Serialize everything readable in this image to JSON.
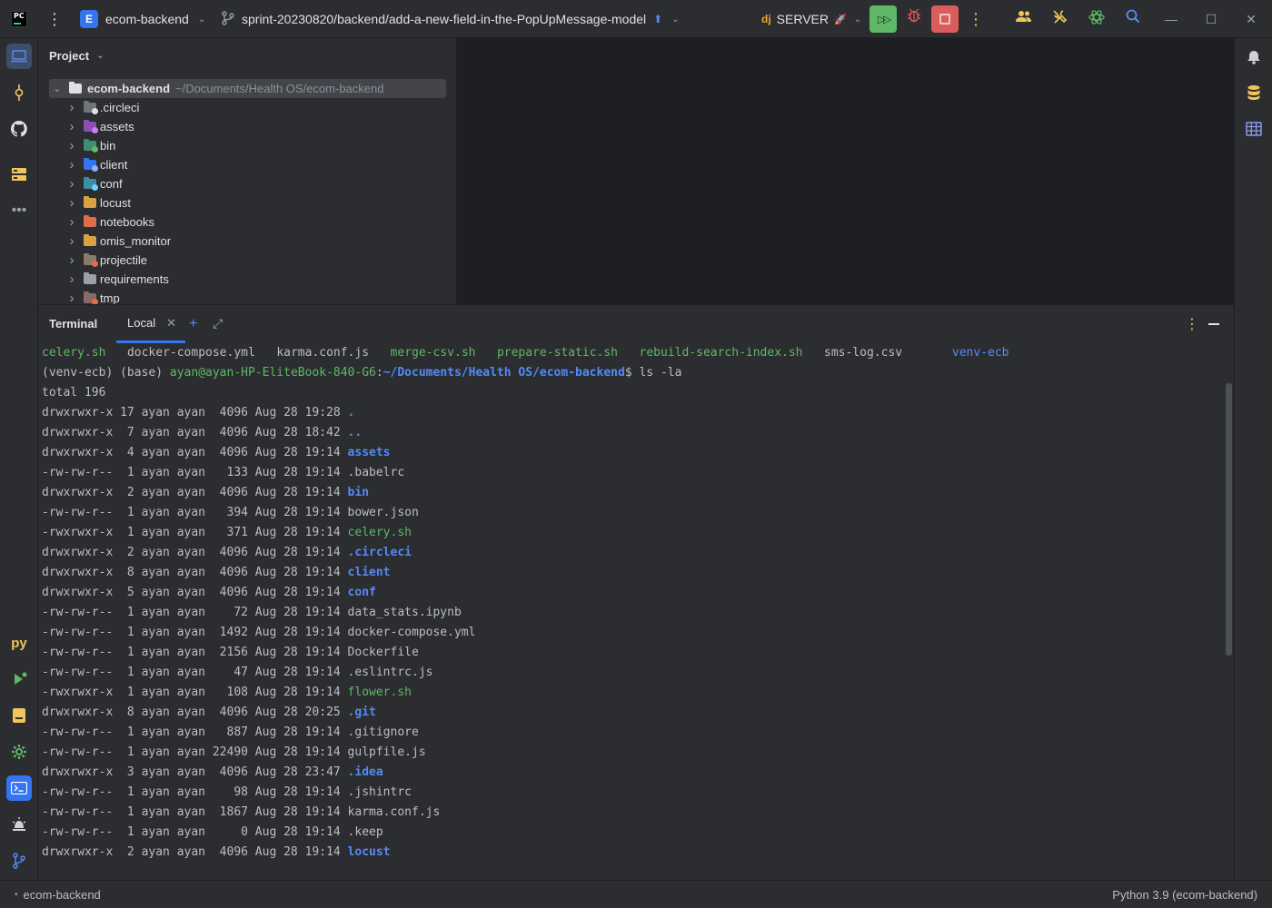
{
  "titlebar": {
    "logo": "PC",
    "project_badge": "E",
    "project_name": "ecom-backend",
    "branch": "sprint-20230820/backend/add-a-new-field-in-the-PopUpMessage-model",
    "run_config": "SERVER"
  },
  "project_panel": {
    "title": "Project",
    "root": {
      "name": "ecom-backend",
      "path": "~/Documents/Health OS/ecom-backend"
    },
    "items": [
      {
        "label": ".circleci",
        "color": "#6f737a",
        "dot": "#dfe1e5"
      },
      {
        "label": "assets",
        "color": "#8e4fb3",
        "dot": "#c77dff"
      },
      {
        "label": "bin",
        "color": "#3f8f6f",
        "dot": "#5fb865"
      },
      {
        "label": "client",
        "color": "#3574f0",
        "dot": "#8ab4ff"
      },
      {
        "label": "conf",
        "color": "#3b8ea5",
        "dot": "#73d0ff"
      },
      {
        "label": "locust",
        "color": "#d9a343",
        "dot": ""
      },
      {
        "label": "notebooks",
        "color": "#e06c4c",
        "dot": ""
      },
      {
        "label": "omis_monitor",
        "color": "#d9a343",
        "dot": ""
      },
      {
        "label": "projectile",
        "color": "#8a7a6b",
        "dot": "#e06c4c"
      },
      {
        "label": "requirements",
        "color": "#9da0a8",
        "dot": ""
      },
      {
        "label": "tmp",
        "color": "#8a6a6a",
        "dot": "#e06c4c"
      }
    ]
  },
  "terminal": {
    "title": "Terminal",
    "tab_label": "Local",
    "file_row": [
      {
        "text": "celery.sh",
        "color": "green"
      },
      {
        "text": "docker-compose.yml",
        "color": "plain"
      },
      {
        "text": "karma.conf.js",
        "color": "plain"
      },
      {
        "text": "merge-csv.sh",
        "color": "green"
      },
      {
        "text": "prepare-static.sh",
        "color": "green"
      },
      {
        "text": "rebuild-search-index.sh",
        "color": "green"
      },
      {
        "text": "sms-log.csv",
        "color": "plain"
      },
      {
        "text": "venv-ecb",
        "color": "blue"
      }
    ],
    "prompt": {
      "env": "(venv-ecb) (base) ",
      "user": "ayan@ayan-HP-EliteBook-840-G6",
      "sep": ":",
      "path": "~/Documents/Health OS/ecom-backend",
      "command": "$ ls -la"
    },
    "total": "total 196",
    "listing": [
      {
        "meta": "drwxrwxr-x 17 ayan ayan  4096 Aug 28 19:28 ",
        "name": ".",
        "type": "dir"
      },
      {
        "meta": "drwxrwxr-x  7 ayan ayan  4096 Aug 28 18:42 ",
        "name": "..",
        "type": "dir"
      },
      {
        "meta": "drwxrwxr-x  4 ayan ayan  4096 Aug 28 19:14 ",
        "name": "assets",
        "type": "dir"
      },
      {
        "meta": "-rw-rw-r--  1 ayan ayan   133 Aug 28 19:14 ",
        "name": ".babelrc",
        "type": "file"
      },
      {
        "meta": "drwxrwxr-x  2 ayan ayan  4096 Aug 28 19:14 ",
        "name": "bin",
        "type": "dir"
      },
      {
        "meta": "-rw-rw-r--  1 ayan ayan   394 Aug 28 19:14 ",
        "name": "bower.json",
        "type": "file"
      },
      {
        "meta": "-rwxrwxr-x  1 ayan ayan   371 Aug 28 19:14 ",
        "name": "celery.sh",
        "type": "exec"
      },
      {
        "meta": "drwxrwxr-x  2 ayan ayan  4096 Aug 28 19:14 ",
        "name": ".circleci",
        "type": "dir"
      },
      {
        "meta": "drwxrwxr-x  8 ayan ayan  4096 Aug 28 19:14 ",
        "name": "client",
        "type": "dir"
      },
      {
        "meta": "drwxrwxr-x  5 ayan ayan  4096 Aug 28 19:14 ",
        "name": "conf",
        "type": "dir"
      },
      {
        "meta": "-rw-rw-r--  1 ayan ayan    72 Aug 28 19:14 ",
        "name": "data_stats.ipynb",
        "type": "file"
      },
      {
        "meta": "-rw-rw-r--  1 ayan ayan  1492 Aug 28 19:14 ",
        "name": "docker-compose.yml",
        "type": "file"
      },
      {
        "meta": "-rw-rw-r--  1 ayan ayan  2156 Aug 28 19:14 ",
        "name": "Dockerfile",
        "type": "file"
      },
      {
        "meta": "-rw-rw-r--  1 ayan ayan    47 Aug 28 19:14 ",
        "name": ".eslintrc.js",
        "type": "file"
      },
      {
        "meta": "-rwxrwxr-x  1 ayan ayan   108 Aug 28 19:14 ",
        "name": "flower.sh",
        "type": "exec"
      },
      {
        "meta": "drwxrwxr-x  8 ayan ayan  4096 Aug 28 20:25 ",
        "name": ".git",
        "type": "dir"
      },
      {
        "meta": "-rw-rw-r--  1 ayan ayan   887 Aug 28 19:14 ",
        "name": ".gitignore",
        "type": "file"
      },
      {
        "meta": "-rw-rw-r--  1 ayan ayan 22490 Aug 28 19:14 ",
        "name": "gulpfile.js",
        "type": "file"
      },
      {
        "meta": "drwxrwxr-x  3 ayan ayan  4096 Aug 28 23:47 ",
        "name": ".idea",
        "type": "dir"
      },
      {
        "meta": "-rw-rw-r--  1 ayan ayan    98 Aug 28 19:14 ",
        "name": ".jshintrc",
        "type": "file"
      },
      {
        "meta": "-rw-rw-r--  1 ayan ayan  1867 Aug 28 19:14 ",
        "name": "karma.conf.js",
        "type": "file"
      },
      {
        "meta": "-rw-rw-r--  1 ayan ayan     0 Aug 28 19:14 ",
        "name": ".keep",
        "type": "file"
      },
      {
        "meta": "drwxrwxr-x  2 ayan ayan  4096 Aug 28 19:14 ",
        "name": "locust",
        "type": "dir"
      }
    ]
  },
  "statusbar": {
    "left": "ecom-backend",
    "right": "Python 3.9 (ecom-backend)"
  }
}
